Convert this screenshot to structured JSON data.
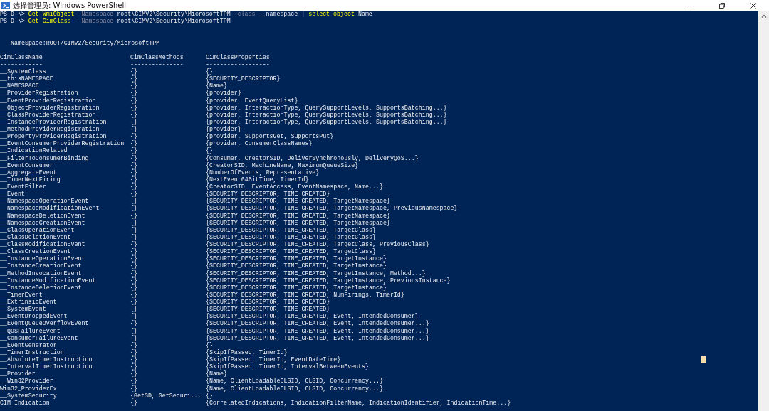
{
  "window": {
    "title": "选择管理员: Windows PowerShell"
  },
  "commands": [
    {
      "segments": [
        {
          "kind": "prompt",
          "text": "PS D:\\> "
        },
        {
          "kind": "command",
          "text": "Get-WmiObject"
        },
        {
          "kind": "parameter",
          "text": " -Namespace"
        },
        {
          "kind": "argument",
          "text": " root\\CIMV2\\Security\\MicrosoftTPM"
        },
        {
          "kind": "parameter",
          "text": " -class"
        },
        {
          "kind": "argument",
          "text": " __namespace | "
        },
        {
          "kind": "command",
          "text": "select-object"
        },
        {
          "kind": "argument",
          "text": " Name"
        }
      ]
    },
    {
      "segments": [
        {
          "kind": "prompt",
          "text": "PS D:\\> "
        },
        {
          "kind": "command",
          "text": "Get-CimClass"
        },
        {
          "kind": "parameter",
          "text": "  -Namespace"
        },
        {
          "kind": "argument",
          "text": " root\\CIMV2\\Security\\MicrosoftTPM"
        }
      ]
    }
  ],
  "namespace_line": "NameSpace:ROOT/CIMV2/Security/MicrosoftTPM",
  "table": {
    "columns": [
      {
        "label": "CimClassName",
        "underline": "------------"
      },
      {
        "label": "CimClassMethods",
        "underline": "---------------"
      },
      {
        "label": "CimClassProperties",
        "underline": "------------------"
      }
    ],
    "rows": [
      [
        "__SystemClass",
        "{}",
        "{}"
      ],
      [
        "__thisNAMESPACE",
        "{}",
        "{SECURITY_DESCRIPTOR}"
      ],
      [
        "__NAMESPACE",
        "{}",
        "{Name}"
      ],
      [
        "__ProviderRegistration",
        "{}",
        "{provider}"
      ],
      [
        "__EventProviderRegistration",
        "{}",
        "{provider, EventQueryList}"
      ],
      [
        "__ObjectProviderRegistration",
        "{}",
        "{provider, InteractionType, QuerySupportLevels, SupportsBatching...}"
      ],
      [
        "__ClassProviderRegistration",
        "{}",
        "{provider, InteractionType, QuerySupportLevels, SupportsBatching...}"
      ],
      [
        "__InstanceProviderRegistration",
        "{}",
        "{provider, InteractionType, QuerySupportLevels, SupportsBatching...}"
      ],
      [
        "__MethodProviderRegistration",
        "{}",
        "{provider}"
      ],
      [
        "__PropertyProviderRegistration",
        "{}",
        "{provider, SupportsGet, SupportsPut}"
      ],
      [
        "__EventConsumerProviderRegistration",
        "{}",
        "{provider, ConsumerClassNames}"
      ],
      [
        "__IndicationRelated",
        "{}",
        "{}"
      ],
      [
        "__FilterToConsumerBinding",
        "{}",
        "{Consumer, CreatorSID, DeliverSynchronously, DeliveryQoS...}"
      ],
      [
        "__EventConsumer",
        "{}",
        "{CreatorSID, MachineName, MaximumQueueSize}"
      ],
      [
        "__AggregateEvent",
        "{}",
        "{NumberOfEvents, Representative}"
      ],
      [
        "__TimerNextFiring",
        "{}",
        "{NextEvent64BitTime, TimerId}"
      ],
      [
        "__EventFilter",
        "{}",
        "{CreatorSID, EventAccess, EventNamespace, Name...}"
      ],
      [
        "__Event",
        "{}",
        "{SECURITY_DESCRIPTOR, TIME_CREATED}"
      ],
      [
        "__NamespaceOperationEvent",
        "{}",
        "{SECURITY_DESCRIPTOR, TIME_CREATED, TargetNamespace}"
      ],
      [
        "__NamespaceModificationEvent",
        "{}",
        "{SECURITY_DESCRIPTOR, TIME_CREATED, TargetNamespace, PreviousNamespace}"
      ],
      [
        "__NamespaceDeletionEvent",
        "{}",
        "{SECURITY_DESCRIPTOR, TIME_CREATED, TargetNamespace}"
      ],
      [
        "__NamespaceCreationEvent",
        "{}",
        "{SECURITY_DESCRIPTOR, TIME_CREATED, TargetNamespace}"
      ],
      [
        "__ClassOperationEvent",
        "{}",
        "{SECURITY_DESCRIPTOR, TIME_CREATED, TargetClass}"
      ],
      [
        "__ClassDeletionEvent",
        "{}",
        "{SECURITY_DESCRIPTOR, TIME_CREATED, TargetClass}"
      ],
      [
        "__ClassModificationEvent",
        "{}",
        "{SECURITY_DESCRIPTOR, TIME_CREATED, TargetClass, PreviousClass}"
      ],
      [
        "__ClassCreationEvent",
        "{}",
        "{SECURITY_DESCRIPTOR, TIME_CREATED, TargetClass}"
      ],
      [
        "__InstanceOperationEvent",
        "{}",
        "{SECURITY_DESCRIPTOR, TIME_CREATED, TargetInstance}"
      ],
      [
        "__InstanceCreationEvent",
        "{}",
        "{SECURITY_DESCRIPTOR, TIME_CREATED, TargetInstance}"
      ],
      [
        "__MethodInvocationEvent",
        "{}",
        "{SECURITY_DESCRIPTOR, TIME_CREATED, TargetInstance, Method...}"
      ],
      [
        "__InstanceModificationEvent",
        "{}",
        "{SECURITY_DESCRIPTOR, TIME_CREATED, TargetInstance, PreviousInstance}"
      ],
      [
        "__InstanceDeletionEvent",
        "{}",
        "{SECURITY_DESCRIPTOR, TIME_CREATED, TargetInstance}"
      ],
      [
        "__TimerEvent",
        "{}",
        "{SECURITY_DESCRIPTOR, TIME_CREATED, NumFirings, TimerId}"
      ],
      [
        "__ExtrinsicEvent",
        "{}",
        "{SECURITY_DESCRIPTOR, TIME_CREATED}"
      ],
      [
        "__SystemEvent",
        "{}",
        "{SECURITY_DESCRIPTOR, TIME_CREATED}"
      ],
      [
        "__EventDroppedEvent",
        "{}",
        "{SECURITY_DESCRIPTOR, TIME_CREATED, Event, IntendedConsumer}"
      ],
      [
        "__EventQueueOverflowEvent",
        "{}",
        "{SECURITY_DESCRIPTOR, TIME_CREATED, Event, IntendedConsumer...}"
      ],
      [
        "__QOSFailureEvent",
        "{}",
        "{SECURITY_DESCRIPTOR, TIME_CREATED, Event, IntendedConsumer...}"
      ],
      [
        "__ConsumerFailureEvent",
        "{}",
        "{SECURITY_DESCRIPTOR, TIME_CREATED, Event, IntendedConsumer...}"
      ],
      [
        "__EventGenerator",
        "{}",
        "{}"
      ],
      [
        "__TimerInstruction",
        "{}",
        "{SkipIfPassed, TimerId}"
      ],
      [
        "__AbsoluteTimerInstruction",
        "{}",
        "{SkipIfPassed, TimerId, EventDateTime}"
      ],
      [
        "__IntervalTimerInstruction",
        "{}",
        "{SkipIfPassed, TimerId, IntervalBetweenEvents}"
      ],
      [
        "__Provider",
        "{}",
        "{Name}"
      ],
      [
        "__Win32Provider",
        "{}",
        "{Name, ClientLoadableCLSID, CLSID, Concurrency...}"
      ],
      [
        "Win32_ProviderEx",
        "{}",
        "{Name, ClientLoadableCLSID, CLSID, Concurrency...}"
      ],
      [
        "__SystemSecurity",
        "{GetSD, GetSecuri...",
        "{}"
      ],
      [
        "CIM_Indication",
        "{}",
        "{CorrelatedIndications, IndicationFilterName, IndicationIdentifier, IndicationTime...}"
      ]
    ]
  }
}
